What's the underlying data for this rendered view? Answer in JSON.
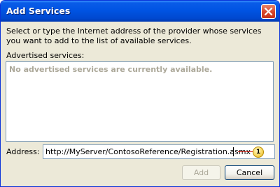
{
  "window": {
    "title": "Add Services"
  },
  "description": "Select or type the Internet address of the provider whose services you want to add to the list of available services.",
  "advertised": {
    "label": "Advertised services:",
    "empty_message": "No advertised services are currently available."
  },
  "address": {
    "label": "Address:",
    "value": "http://MyServer/ContosoReference/Registration.asmx"
  },
  "callout": {
    "number": "1"
  },
  "buttons": {
    "add": "Add",
    "cancel": "Cancel"
  }
}
